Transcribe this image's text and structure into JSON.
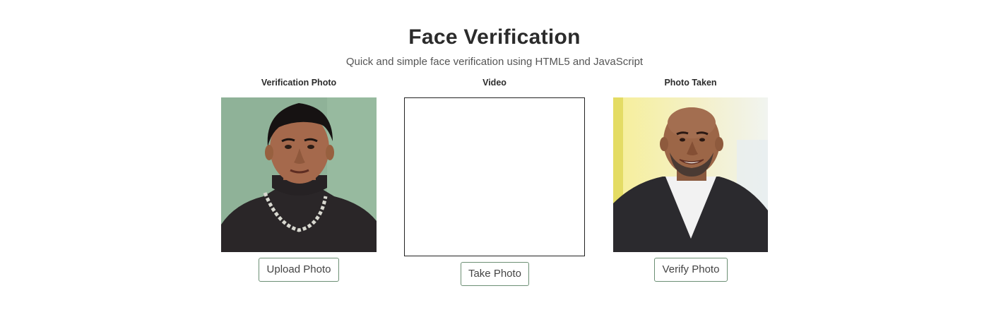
{
  "header": {
    "title": "Face Verification",
    "subtitle": "Quick and simple face verification using HTML5 and JavaScript"
  },
  "columns": {
    "verification": {
      "label": "Verification Photo",
      "button_label": "Upload Photo"
    },
    "video": {
      "label": "Video",
      "button_label": "Take Photo"
    },
    "taken": {
      "label": "Photo Taken",
      "button_label": "Verify Photo"
    }
  },
  "colors": {
    "button_border": "#6c8f74",
    "verification_bg": "#8fb298",
    "taken_bg": "#f3ee9a"
  }
}
